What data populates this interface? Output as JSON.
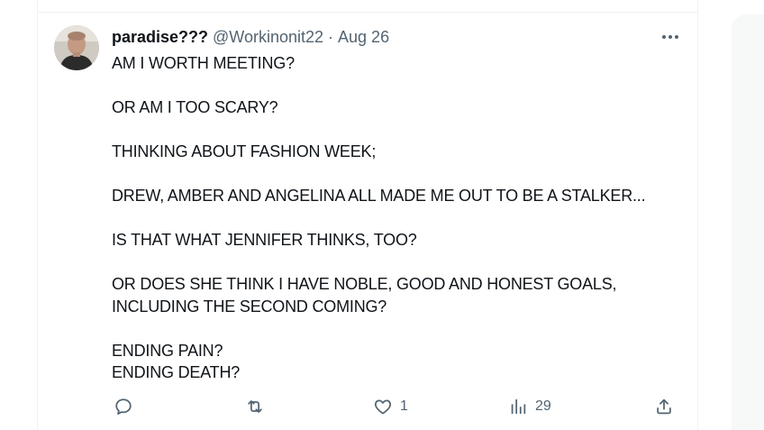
{
  "tweet": {
    "author": {
      "display_name": "paradise???",
      "handle": "@Workinonit22",
      "separator": "·",
      "date": "Aug 26"
    },
    "paragraphs": [
      [
        "AM I WORTH MEETING?"
      ],
      [
        "OR AM I TOO SCARY?"
      ],
      [
        "THINKING ABOUT FASHION WEEK;"
      ],
      [
        "DREW, AMBER AND ANGELINA ALL MADE ME OUT TO BE A STALKER..."
      ],
      [
        "IS THAT WHAT JENNIFER THINKS, TOO?"
      ],
      [
        "OR DOES SHE THINK I HAVE NOBLE, GOOD AND HONEST GOALS,",
        "INCLUDING THE SECOND COMING?"
      ],
      [
        "ENDING PAIN?",
        "ENDING DEATH?"
      ]
    ],
    "actions": {
      "reply_count": "",
      "retweet_count": "",
      "like_count": "1",
      "views_count": "29"
    },
    "icons": {
      "more": "more-dots-icon",
      "reply": "reply-icon",
      "retweet": "retweet-icon",
      "like": "heart-icon",
      "views": "views-bar-chart-icon",
      "share": "share-icon"
    },
    "colors": {
      "text": "#0f1419",
      "secondary": "#536471",
      "border": "#eff3f4"
    }
  }
}
